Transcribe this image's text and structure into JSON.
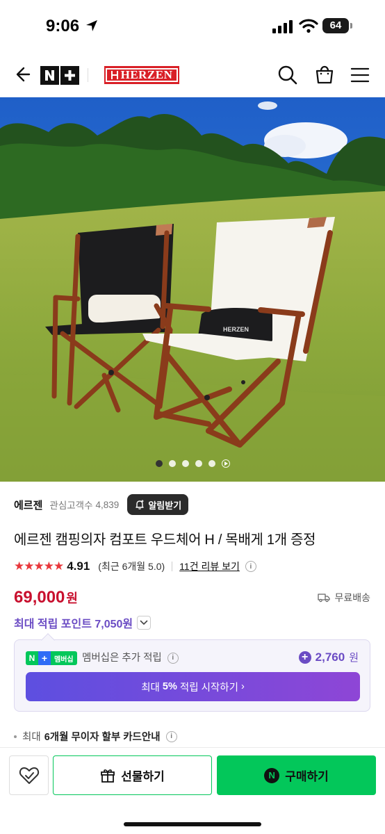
{
  "status_bar": {
    "time": "9:06",
    "battery": "64"
  },
  "header": {
    "back_icon": "arrow-left-icon",
    "nplus_logo": "N+",
    "brand_logo": "HERZEN",
    "search_icon": "search-icon",
    "cart_icon": "shopping-bag-icon",
    "menu_icon": "hamburger-menu-icon"
  },
  "hero": {
    "image_count": 6,
    "active_index": 0
  },
  "store": {
    "name": "에르젠",
    "fans_label": "관심고객수",
    "fans_count": "4,839",
    "notify_label": "알림받기"
  },
  "product": {
    "title": "에르젠 캠핑의자 컴포트 우드체어 H / 목배게 1개 증정",
    "rating_stars": "★★★★★",
    "rating": "4.91",
    "recent_rating": "(최근 6개월 5.0)",
    "reviews_link": "11건 리뷰 보기",
    "price": "69,000",
    "price_unit": "원",
    "shipping": "무료배송",
    "max_points": "최대 적립 포인트 7,050원"
  },
  "membership": {
    "badge_n": "N",
    "badge_plus": "+",
    "badge_text": "멤버십",
    "text": "멤버십은 추가 적립",
    "points": "2,760",
    "points_unit": "원",
    "cta_prefix": "최대",
    "cta_bold": "5%",
    "cta_suffix": "적립 시작하기",
    "cta_arrow": "›"
  },
  "installment": {
    "prefix": "최대",
    "bold": "6개월 무이자 할부 카드안내"
  },
  "bottom_bar": {
    "wish_icon": "heart-check-icon",
    "gift_label": "선물하기",
    "buy_label": "구매하기",
    "npay_letter": "N"
  },
  "colors": {
    "naver_green": "#03c75a",
    "price_red": "#c8102e",
    "points_purple": "#6b4cc4",
    "brand_red": "#d92027"
  }
}
